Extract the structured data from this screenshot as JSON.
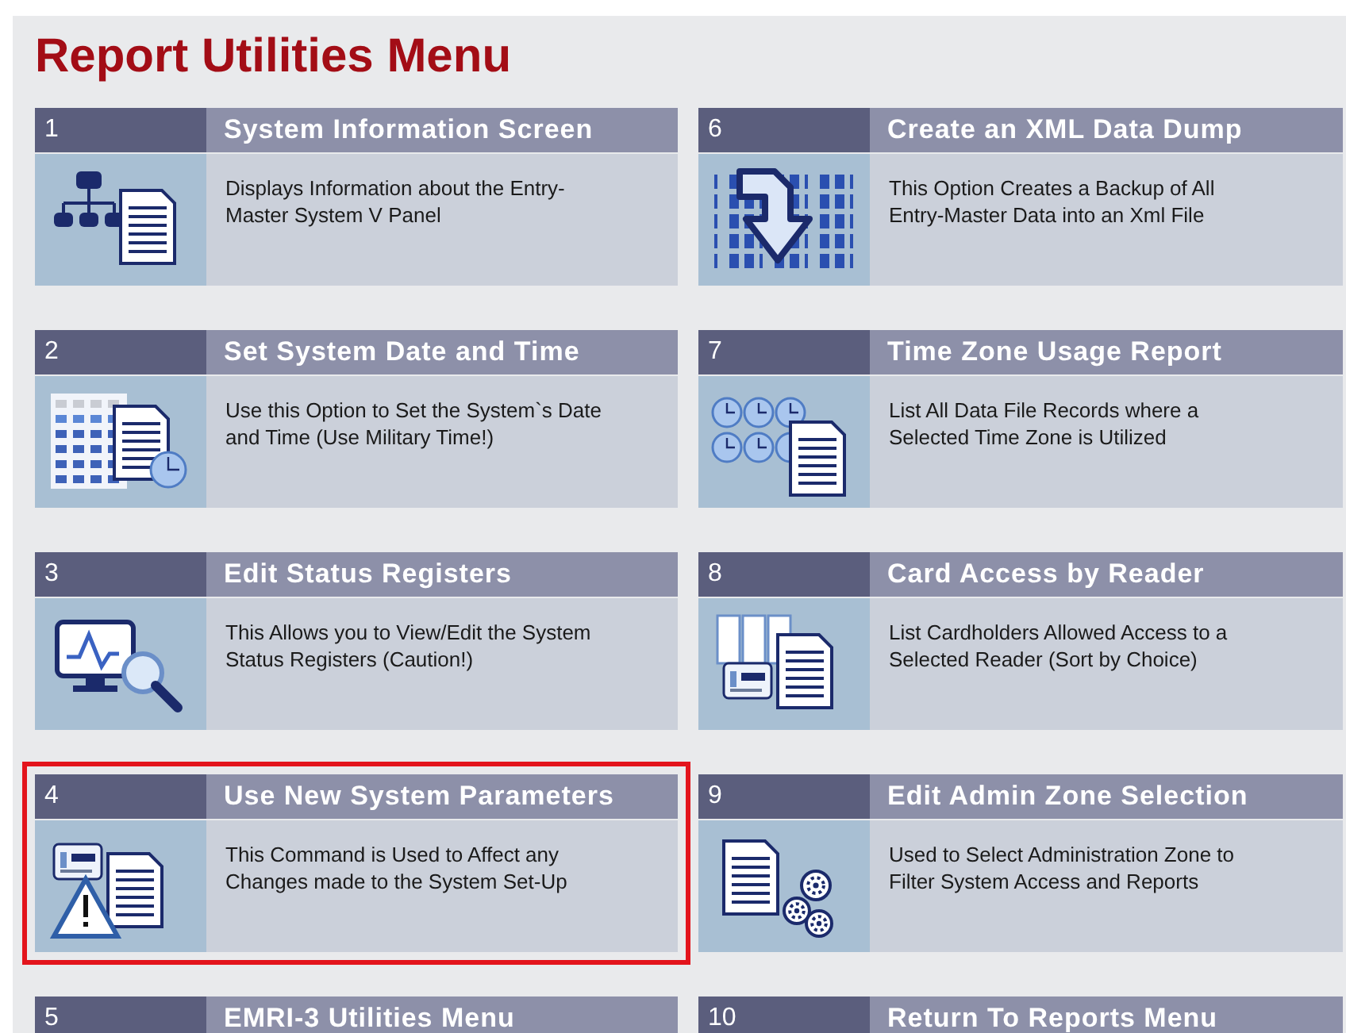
{
  "title": "Report Utilities Menu",
  "columns": [
    {
      "tiles": [
        {
          "number": "1",
          "title": "System Information Screen",
          "description": "Displays Information about the Entry-Master System V Panel",
          "kind": "hierarchy",
          "highlighted": false
        },
        {
          "number": "2",
          "title": "Set System Date and Time",
          "description": "Use this Option to Set the System`s Date and Time (Use Military Time!)",
          "kind": "calendar",
          "highlighted": false
        },
        {
          "number": "3",
          "title": "Edit Status Registers",
          "description": "This Allows you to View/Edit the System Status Registers (Caution!)",
          "kind": "monitor",
          "highlighted": false
        },
        {
          "number": "4",
          "title": "Use New System Parameters",
          "description": "This Command is Used to Affect any Changes made to the System Set-Up",
          "kind": "warning",
          "highlighted": true
        },
        {
          "number": "5",
          "title": "EMRI-3 Utilities Menu",
          "highlighted": false
        }
      ]
    },
    {
      "tiles": [
        {
          "number": "6",
          "title": "Create an XML Data Dump",
          "description": "This Option Creates a Backup of All Entry-Master Data into an Xml File",
          "kind": "binary",
          "highlighted": false
        },
        {
          "number": "7",
          "title": "Time Zone Usage Report",
          "description": "List All Data File Records where a Selected Time Zone is Utilized",
          "kind": "clocks",
          "highlighted": false
        },
        {
          "number": "8",
          "title": "Card Access by Reader",
          "description": "List Cardholders Allowed Access to a Selected Reader (Sort by Choice)",
          "kind": "cards",
          "highlighted": false
        },
        {
          "number": "9",
          "title": "Edit Admin Zone Selection",
          "description": "Used to Select Administration Zone to Filter System Access and Reports",
          "kind": "gears",
          "highlighted": false
        },
        {
          "number": "10",
          "title": "Return To Reports Menu",
          "highlighted": false
        }
      ]
    }
  ]
}
